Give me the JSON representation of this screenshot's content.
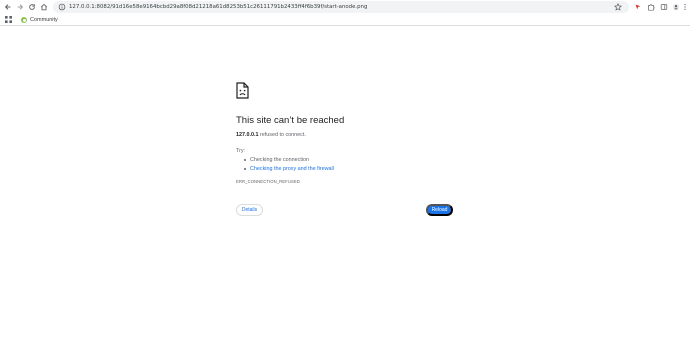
{
  "toolbar": {
    "back_icon": "back-arrow-icon",
    "forward_icon": "forward-arrow-icon",
    "reload_icon": "reload-icon",
    "home_icon": "home-icon",
    "url": "127.0.0.1:8082/91d16e58e9164bcbd29a8f08d21218a61d8253b51c26111791b2433ff4f6b39f/start-anode.png",
    "star_icon": "bookmark-star-icon",
    "extension_icons": [
      "extension-red-icon",
      "extensions-puzzle-icon",
      "side-panel-icon",
      "profile-avatar-icon",
      "menu-kebab-icon"
    ]
  },
  "bookmarks_bar": {
    "apps_icon": "apps-grid-icon",
    "items": [
      {
        "label": "Community",
        "icon": "community-favicon"
      }
    ]
  },
  "error": {
    "icon": "sad-document-icon",
    "headline": "This site can’t be reached",
    "host": "127.0.0.1",
    "summary_rest": " refused to connect.",
    "try_label": "Try:",
    "suggestions": [
      {
        "text": "Checking the connection",
        "link": false
      },
      {
        "text": "Checking the proxy and the firewall",
        "link": true
      }
    ],
    "error_code": "ERR_CONNECTION_REFUSED",
    "details_label": "Details",
    "reload_label": "Reload"
  },
  "colors": {
    "accent": "#1a73e8",
    "text_primary": "#202124",
    "text_secondary": "#5f6368"
  }
}
